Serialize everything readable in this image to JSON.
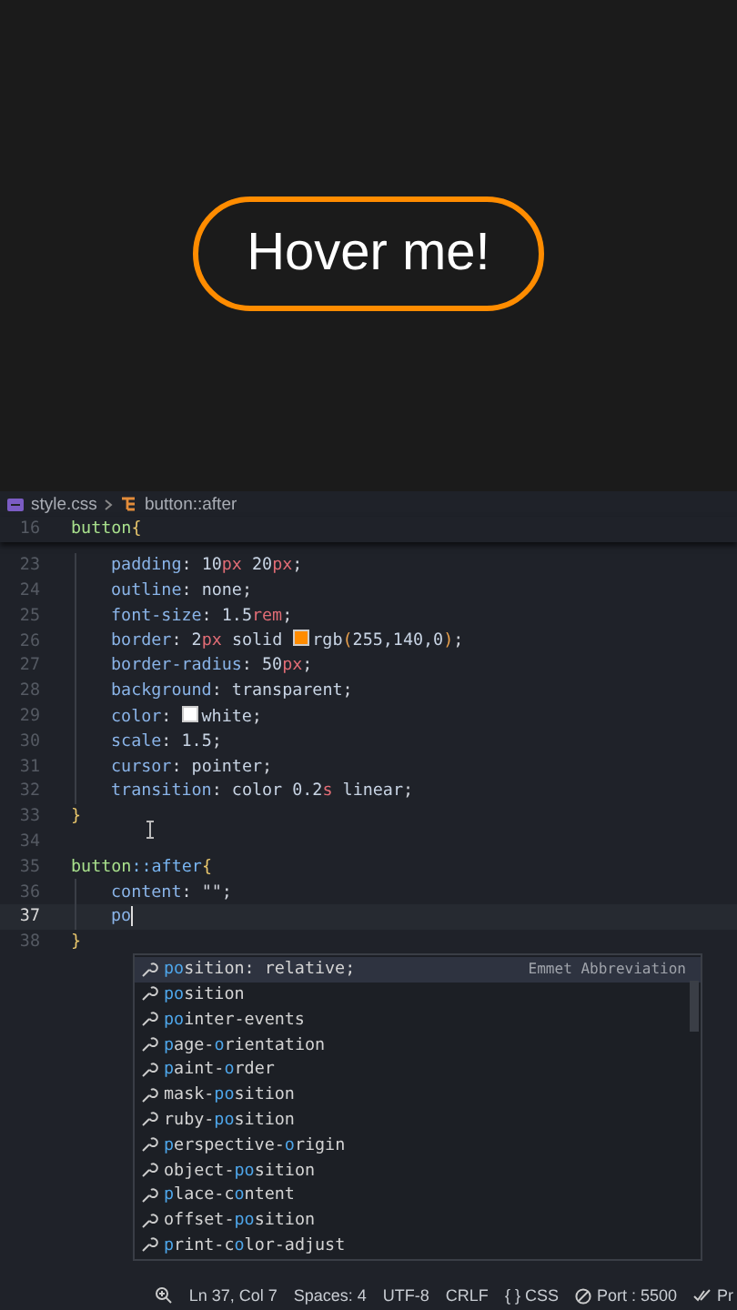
{
  "preview": {
    "button_label": "Hover me!"
  },
  "breadcrumb": {
    "file": "style.css",
    "symbol": "button::after"
  },
  "sticky_line": {
    "number": "16",
    "tokens": [
      {
        "kind": "sel",
        "text": "button"
      },
      {
        "kind": "brace",
        "text": "{"
      }
    ]
  },
  "code_lines": [
    {
      "number": "23",
      "indented": true,
      "current": false,
      "tokens": [
        {
          "kind": "prop",
          "text": "padding"
        },
        {
          "kind": "punct",
          "text": ": "
        },
        {
          "kind": "num",
          "text": "10"
        },
        {
          "kind": "unit",
          "text": "px"
        },
        {
          "kind": "num",
          "text": " 20"
        },
        {
          "kind": "unit",
          "text": "px"
        },
        {
          "kind": "punct",
          "text": ";"
        }
      ]
    },
    {
      "number": "24",
      "indented": true,
      "current": false,
      "tokens": [
        {
          "kind": "prop",
          "text": "outline"
        },
        {
          "kind": "punct",
          "text": ": "
        },
        {
          "kind": "val",
          "text": "none"
        },
        {
          "kind": "punct",
          "text": ";"
        }
      ]
    },
    {
      "number": "25",
      "indented": true,
      "current": false,
      "tokens": [
        {
          "kind": "prop",
          "text": "font-size"
        },
        {
          "kind": "punct",
          "text": ": "
        },
        {
          "kind": "num",
          "text": "1.5"
        },
        {
          "kind": "unit",
          "text": "rem"
        },
        {
          "kind": "punct",
          "text": ";"
        }
      ]
    },
    {
      "number": "26",
      "indented": true,
      "current": false,
      "tokens": [
        {
          "kind": "prop",
          "text": "border"
        },
        {
          "kind": "punct",
          "text": ": "
        },
        {
          "kind": "num",
          "text": "2"
        },
        {
          "kind": "unit",
          "text": "px"
        },
        {
          "kind": "val",
          "text": " solid "
        },
        {
          "kind": "swatch",
          "color": "#ff8c00"
        },
        {
          "kind": "val",
          "text": "rgb"
        },
        {
          "kind": "paren",
          "text": "("
        },
        {
          "kind": "num",
          "text": "255,140,0"
        },
        {
          "kind": "paren",
          "text": ")"
        },
        {
          "kind": "punct",
          "text": ";"
        }
      ]
    },
    {
      "number": "27",
      "indented": true,
      "current": false,
      "tokens": [
        {
          "kind": "prop",
          "text": "border-radius"
        },
        {
          "kind": "punct",
          "text": ": "
        },
        {
          "kind": "num",
          "text": "50"
        },
        {
          "kind": "unit",
          "text": "px"
        },
        {
          "kind": "punct",
          "text": ";"
        }
      ]
    },
    {
      "number": "28",
      "indented": true,
      "current": false,
      "tokens": [
        {
          "kind": "prop",
          "text": "background"
        },
        {
          "kind": "punct",
          "text": ": "
        },
        {
          "kind": "val",
          "text": "transparent"
        },
        {
          "kind": "punct",
          "text": ";"
        }
      ]
    },
    {
      "number": "29",
      "indented": true,
      "current": false,
      "tokens": [
        {
          "kind": "prop",
          "text": "color"
        },
        {
          "kind": "punct",
          "text": ": "
        },
        {
          "kind": "swatch",
          "color": "#ffffff"
        },
        {
          "kind": "val",
          "text": "white"
        },
        {
          "kind": "punct",
          "text": ";"
        }
      ]
    },
    {
      "number": "30",
      "indented": true,
      "current": false,
      "tokens": [
        {
          "kind": "prop",
          "text": "scale"
        },
        {
          "kind": "punct",
          "text": ": "
        },
        {
          "kind": "num",
          "text": "1.5"
        },
        {
          "kind": "punct",
          "text": ";"
        }
      ]
    },
    {
      "number": "31",
      "indented": true,
      "current": false,
      "tokens": [
        {
          "kind": "prop",
          "text": "cursor"
        },
        {
          "kind": "punct",
          "text": ": "
        },
        {
          "kind": "val",
          "text": "pointer"
        },
        {
          "kind": "punct",
          "text": ";"
        }
      ]
    },
    {
      "number": "32",
      "indented": true,
      "current": false,
      "tokens": [
        {
          "kind": "prop",
          "text": "transition"
        },
        {
          "kind": "punct",
          "text": ": "
        },
        {
          "kind": "val",
          "text": "color "
        },
        {
          "kind": "num",
          "text": "0.2"
        },
        {
          "kind": "unit",
          "text": "s"
        },
        {
          "kind": "val",
          "text": " linear"
        },
        {
          "kind": "punct",
          "text": ";"
        }
      ]
    },
    {
      "number": "33",
      "indented": false,
      "current": false,
      "tokens": [
        {
          "kind": "brace",
          "text": "}"
        }
      ]
    },
    {
      "number": "34",
      "indented": false,
      "current": false
    },
    {
      "number": "35",
      "indented": false,
      "current": false,
      "tokens": [
        {
          "kind": "sel",
          "text": "button"
        },
        {
          "kind": "pseudo",
          "text": "::after"
        },
        {
          "kind": "brace",
          "text": "{"
        }
      ]
    },
    {
      "number": "36",
      "indented": true,
      "current": false,
      "tokens": [
        {
          "kind": "prop",
          "text": "content"
        },
        {
          "kind": "punct",
          "text": ": "
        },
        {
          "kind": "str",
          "text": "\"\""
        },
        {
          "kind": "punct",
          "text": ";"
        }
      ]
    },
    {
      "number": "37",
      "indented": true,
      "current": true,
      "tokens": [
        {
          "kind": "prop",
          "text": "po"
        }
      ]
    },
    {
      "number": "38",
      "indented": false,
      "current": false,
      "tokens": [
        {
          "kind": "brace",
          "text": "}"
        }
      ]
    }
  ],
  "suggestions": {
    "detail": "Emmet Abbreviation",
    "items": [
      {
        "selected": true,
        "parts": [
          {
            "text": "po",
            "matched": true
          },
          {
            "text": "sition: relative;",
            "matched": false
          }
        ]
      },
      {
        "selected": false,
        "parts": [
          {
            "text": "po",
            "matched": true
          },
          {
            "text": "sition",
            "matched": false
          }
        ]
      },
      {
        "selected": false,
        "parts": [
          {
            "text": "po",
            "matched": true
          },
          {
            "text": "inter-events",
            "matched": false
          }
        ]
      },
      {
        "selected": false,
        "parts": [
          {
            "text": "p",
            "matched": true
          },
          {
            "text": "age-",
            "matched": false
          },
          {
            "text": "o",
            "matched": true
          },
          {
            "text": "rientation",
            "matched": false
          }
        ]
      },
      {
        "selected": false,
        "parts": [
          {
            "text": "p",
            "matched": true
          },
          {
            "text": "aint-",
            "matched": false
          },
          {
            "text": "o",
            "matched": true
          },
          {
            "text": "rder",
            "matched": false
          }
        ]
      },
      {
        "selected": false,
        "parts": [
          {
            "text": "mask-",
            "matched": false
          },
          {
            "text": "po",
            "matched": true
          },
          {
            "text": "sition",
            "matched": false
          }
        ]
      },
      {
        "selected": false,
        "parts": [
          {
            "text": "ruby-",
            "matched": false
          },
          {
            "text": "po",
            "matched": true
          },
          {
            "text": "sition",
            "matched": false
          }
        ]
      },
      {
        "selected": false,
        "parts": [
          {
            "text": "p",
            "matched": true
          },
          {
            "text": "erspective-",
            "matched": false
          },
          {
            "text": "o",
            "matched": true
          },
          {
            "text": "rigin",
            "matched": false
          }
        ]
      },
      {
        "selected": false,
        "parts": [
          {
            "text": "object-",
            "matched": false
          },
          {
            "text": "po",
            "matched": true
          },
          {
            "text": "sition",
            "matched": false
          }
        ]
      },
      {
        "selected": false,
        "parts": [
          {
            "text": "p",
            "matched": true
          },
          {
            "text": "lace-c",
            "matched": false
          },
          {
            "text": "o",
            "matched": true
          },
          {
            "text": "ntent",
            "matched": false
          }
        ]
      },
      {
        "selected": false,
        "parts": [
          {
            "text": "offset-",
            "matched": false
          },
          {
            "text": "po",
            "matched": true
          },
          {
            "text": "sition",
            "matched": false
          }
        ]
      },
      {
        "selected": false,
        "parts": [
          {
            "text": "p",
            "matched": true
          },
          {
            "text": "rint-c",
            "matched": false
          },
          {
            "text": "o",
            "matched": true
          },
          {
            "text": "lor-adjust",
            "matched": false
          }
        ]
      }
    ]
  },
  "status_bar": [
    {
      "kind": "zoom"
    },
    {
      "kind": "text",
      "text": "Ln 37, Col 7"
    },
    {
      "kind": "text",
      "text": "Spaces: 4"
    },
    {
      "kind": "text",
      "text": "UTF-8"
    },
    {
      "kind": "text",
      "text": "CRLF"
    },
    {
      "kind": "text",
      "text": "{ } CSS"
    },
    {
      "kind": "port",
      "text": "Port : 5500"
    },
    {
      "kind": "check",
      "text": "Pr"
    }
  ]
}
